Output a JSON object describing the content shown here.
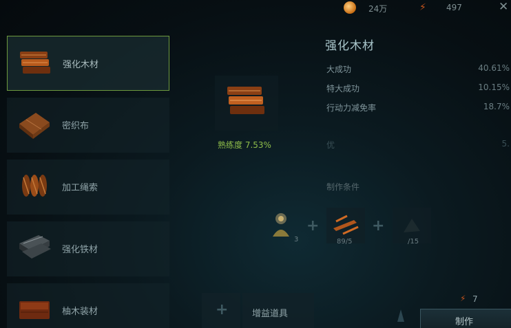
{
  "topbar": {
    "currency_value": "24万",
    "energy_value": "497",
    "coin_icon": "coin-icon",
    "energy_icon": "lightning-icon",
    "close_icon": "close-icon"
  },
  "recipes": [
    {
      "label": "强化木材",
      "selected": true,
      "icon": "wood-plank-icon"
    },
    {
      "label": "密织布",
      "selected": false,
      "icon": "cloth-icon"
    },
    {
      "label": "加工绳索",
      "selected": false,
      "icon": "rope-icon"
    },
    {
      "label": "强化铁材",
      "selected": false,
      "icon": "iron-ingot-icon"
    },
    {
      "label": "柚木装材",
      "selected": false,
      "icon": "teak-wood-icon"
    }
  ],
  "detail": {
    "title": "强化木材",
    "proficiency": "熟练度 7.53%",
    "stats": [
      {
        "name": "大成功",
        "value": "40.61%",
        "faded": false
      },
      {
        "name": "特大成功",
        "value": "10.15%",
        "faded": false
      },
      {
        "name": "行动力减免率",
        "value": "18.7%",
        "faded": false
      },
      {
        "name": "",
        "value": "",
        "faded": true
      },
      {
        "name": "优",
        "value": "5.",
        "faded": true
      }
    ],
    "conditions_label": "制作条件",
    "materials": [
      {
        "count": "3",
        "icon": "character-icon"
      },
      {
        "count": "89/5",
        "icon": "timber-icon"
      },
      {
        "count": "/15",
        "icon": "material-icon"
      }
    ]
  },
  "boost": {
    "label": "增益道具"
  },
  "action": {
    "cost": "7",
    "make_label": "制作"
  },
  "colors": {
    "selected_border": "#6e9a3e",
    "proficiency": "#8fbd4a",
    "energy": "#c4531c",
    "title": "#a9c6cb"
  }
}
